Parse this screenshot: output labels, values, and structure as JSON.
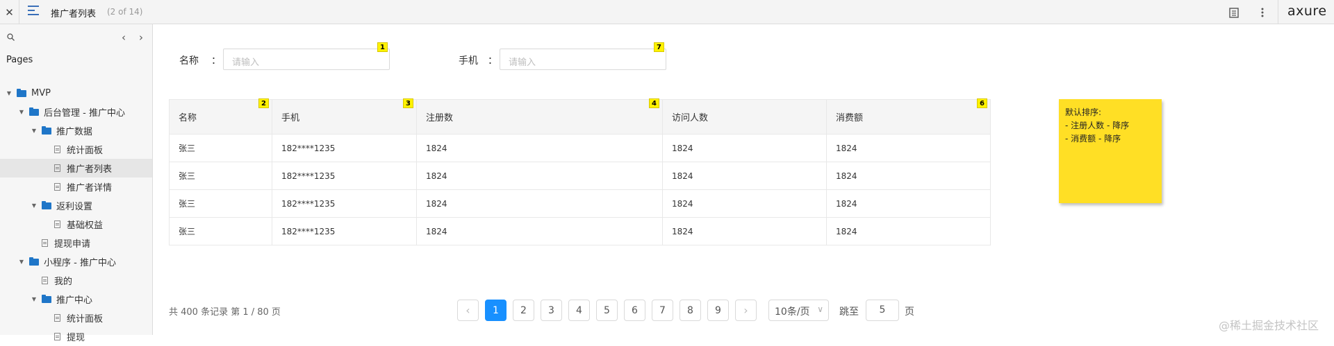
{
  "topbar": {
    "close_icon": "✕",
    "title": "推广者列表",
    "page_count": "(2 of 14)",
    "logo": "axure"
  },
  "sidebar": {
    "header": "Pages",
    "tree": [
      {
        "label": "MVP",
        "type": "folder",
        "level": 0,
        "expanded": true
      },
      {
        "label": "后台管理 - 推广中心",
        "type": "folder",
        "level": 1,
        "expanded": true
      },
      {
        "label": "推广数据",
        "type": "folder",
        "level": 2,
        "expanded": true
      },
      {
        "label": "统计面板",
        "type": "page",
        "level": 3
      },
      {
        "label": "推广者列表",
        "type": "page",
        "level": 3,
        "selected": true
      },
      {
        "label": "推广者详情",
        "type": "page",
        "level": 3
      },
      {
        "label": "返利设置",
        "type": "folder",
        "level": 2,
        "expanded": true
      },
      {
        "label": "基础权益",
        "type": "page",
        "level": 3
      },
      {
        "label": "提现申请",
        "type": "page",
        "level": 2
      },
      {
        "label": "小程序 - 推广中心",
        "type": "folder",
        "level": 1,
        "expanded": true
      },
      {
        "label": "我的",
        "type": "page",
        "level": 2
      },
      {
        "label": "推广中心",
        "type": "folder",
        "level": 2,
        "expanded": true
      },
      {
        "label": "统计面板",
        "type": "page",
        "level": 3
      },
      {
        "label": "提现",
        "type": "page",
        "level": 3
      }
    ]
  },
  "form": {
    "name_label": "名称",
    "name_colon": "：",
    "name_placeholder": "请输入",
    "phone_label": "手机",
    "phone_colon": "：",
    "phone_placeholder": "请输入"
  },
  "badges": [
    "1",
    "2",
    "3",
    "4",
    "6",
    "7"
  ],
  "table": {
    "headers": [
      "名称",
      "手机",
      "注册数",
      "访问人数",
      "消费额"
    ],
    "rows": [
      [
        "张三",
        "182****1235",
        "1824",
        "1824",
        "1824"
      ],
      [
        "张三",
        "182****1235",
        "1824",
        "1824",
        "1824"
      ],
      [
        "张三",
        "182****1235",
        "1824",
        "1824",
        "1824"
      ],
      [
        "张三",
        "182****1235",
        "1824",
        "1824",
        "1824"
      ]
    ]
  },
  "note": {
    "line1": "默认排序:",
    "line2": "- 注册人数 - 降序",
    "line3": "- 消费额 - 降序"
  },
  "pagination": {
    "total_text": "共 400 条记录 第 1 / 80 页",
    "prev": "‹",
    "next": "›",
    "pages": [
      "1",
      "2",
      "3",
      "4",
      "5",
      "6",
      "7",
      "8",
      "9"
    ],
    "current": "1",
    "page_size": "10条/页",
    "jump_label": "跳至",
    "jump_value": "5",
    "jump_suffix": "页"
  },
  "watermark": "@稀土掘金技术社区",
  "colors": {
    "accent": "#1890ff",
    "note_bg": "#ffdf25",
    "folder": "#1f76c8",
    "badge": "#fff200"
  }
}
